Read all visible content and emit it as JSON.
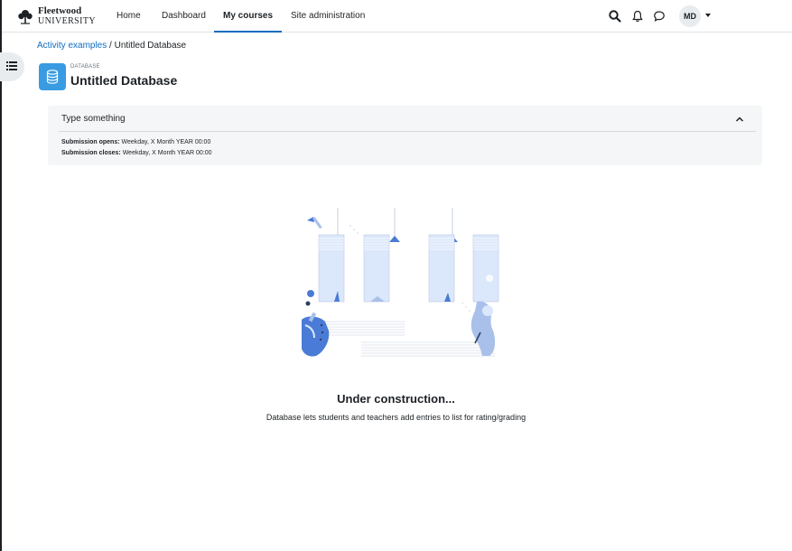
{
  "brand": {
    "line1": "Fleetwood",
    "line2": "UNIVERSITY"
  },
  "nav": {
    "items": [
      {
        "label": "Home"
      },
      {
        "label": "Dashboard"
      },
      {
        "label": "My courses",
        "active": true
      },
      {
        "label": "Site administration"
      }
    ]
  },
  "user": {
    "initials": "MD"
  },
  "breadcrumb": {
    "parent": "Activity examples",
    "separator": " / ",
    "current": "Untitled Database"
  },
  "activity": {
    "type": "DATABASE",
    "title": "Untitled Database",
    "icon": "database-icon"
  },
  "info": {
    "header": "Type something",
    "opens_label": "Submission opens:",
    "opens_value": " Weekday, X Month YEAR 00:00",
    "closes_label": "Submission closes:",
    "closes_value": " Weekday, X Month YEAR 00:00"
  },
  "empty_state": {
    "title": "Under construction...",
    "description": "Database lets students and teachers add entries to list for rating/grading"
  },
  "colors": {
    "accent": "#0f6cbf",
    "activity_icon_bg": "#399be2",
    "illustration_blue": "#4a7bd6",
    "illustration_light": "#dbe7fb"
  }
}
